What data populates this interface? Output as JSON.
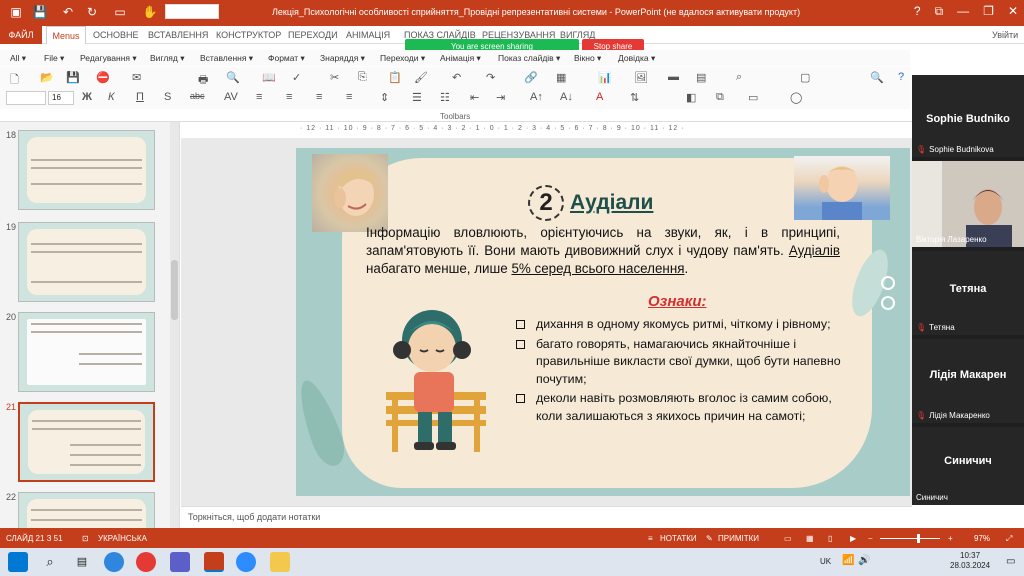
{
  "window": {
    "title": "Лекція_Психологічні особливості сприйняття_Провідні репрезентативні системи -  PowerPoint (не вдалося активувати продукт)",
    "controls": [
      "?",
      "⧉",
      "—",
      "❐",
      "✕"
    ],
    "user": "Увійти"
  },
  "ribbon": {
    "tabs": [
      "ФАЙЛ",
      "Menus",
      "ОСНОВНЕ",
      "ВСТАВЛЕННЯ",
      "КОНСТРУКТОР",
      "ПЕРЕХОДИ",
      "АНІМАЦІЯ",
      "ПОКАЗ СЛАЙДІВ",
      "РЕЦЕНЗУВАННЯ",
      "ВИГЛЯД"
    ],
    "menus": [
      "All ▾",
      "File ▾",
      "Редагування ▾",
      "Вигляд ▾",
      "Вставлення ▾",
      "Формат ▾",
      "Знаряддя ▾",
      "Переходи ▾",
      "Анімація ▾",
      "Показ слайдів ▾",
      "Вікно ▾",
      "Довідка ▾"
    ],
    "font_size": "16",
    "format_buttons": [
      "Ж",
      "К",
      "П",
      "S",
      "abc"
    ],
    "toolbars_label": "Toolbars"
  },
  "sharing": {
    "banner": "You are screen sharing",
    "stop": "Stop share"
  },
  "ruler": "· 12 · 11 · 10 · 9 · 8 · 7 · 6 · 5 · 4 · 3 · 2 · 1 · 0 · 1 · 2 · 3 · 4 · 5 · 6 · 7 · 8 · 9 · 10 · 11 · 12 ·",
  "thumbnails": [
    {
      "number": "18"
    },
    {
      "number": "19"
    },
    {
      "number": "20"
    },
    {
      "number": "21"
    },
    {
      "number": "22"
    }
  ],
  "slide": {
    "badge": "2",
    "title": "Аудіали",
    "para_a": "Інформацію вловлюють, орієнтуючись на звуки, як, і в принципі, запам'ятовують її. Вони мають дивовижний слух і чудову пам'ять. ",
    "para_b": "Аудіалів",
    "para_c": " набагато менше, лише ",
    "para_d": "5% серед всього населення",
    "para_e": ".",
    "signs_title": "Ознаки:",
    "bullets": [
      "дихання в одному якомусь ритмі, чіткому і рівному;",
      "багато говорять, намагаючись якнайточніше і правильніше викласти свої думки, щоб бути напевно почутим;",
      "деколи навіть розмовляють вголос із самим собою, коли залишаються з якихось причин на самоті;"
    ]
  },
  "notes_placeholder": "Торкніться, щоб додати нотатки",
  "status": {
    "slide": "СЛАЙД 21 З 51",
    "language": "УКРАЇНСЬКА",
    "notes": "НОТАТКИ",
    "comments": "ПРИМІТКИ",
    "zoom": "97%"
  },
  "participants": [
    {
      "big": "Sophie Budniko",
      "small": "Sophie Budnikova"
    },
    {
      "big": "",
      "small": "Вікторія Лазаренко"
    },
    {
      "big": "Тетяна",
      "small": "Тетяна"
    },
    {
      "big": "Лідія Макарен",
      "small": "Лідія Макаренко"
    },
    {
      "big": "Синичич",
      "small": "Синичич"
    }
  ],
  "taskbar": {
    "lang": "UK",
    "time": "10:37",
    "date": "28.03.2024"
  }
}
